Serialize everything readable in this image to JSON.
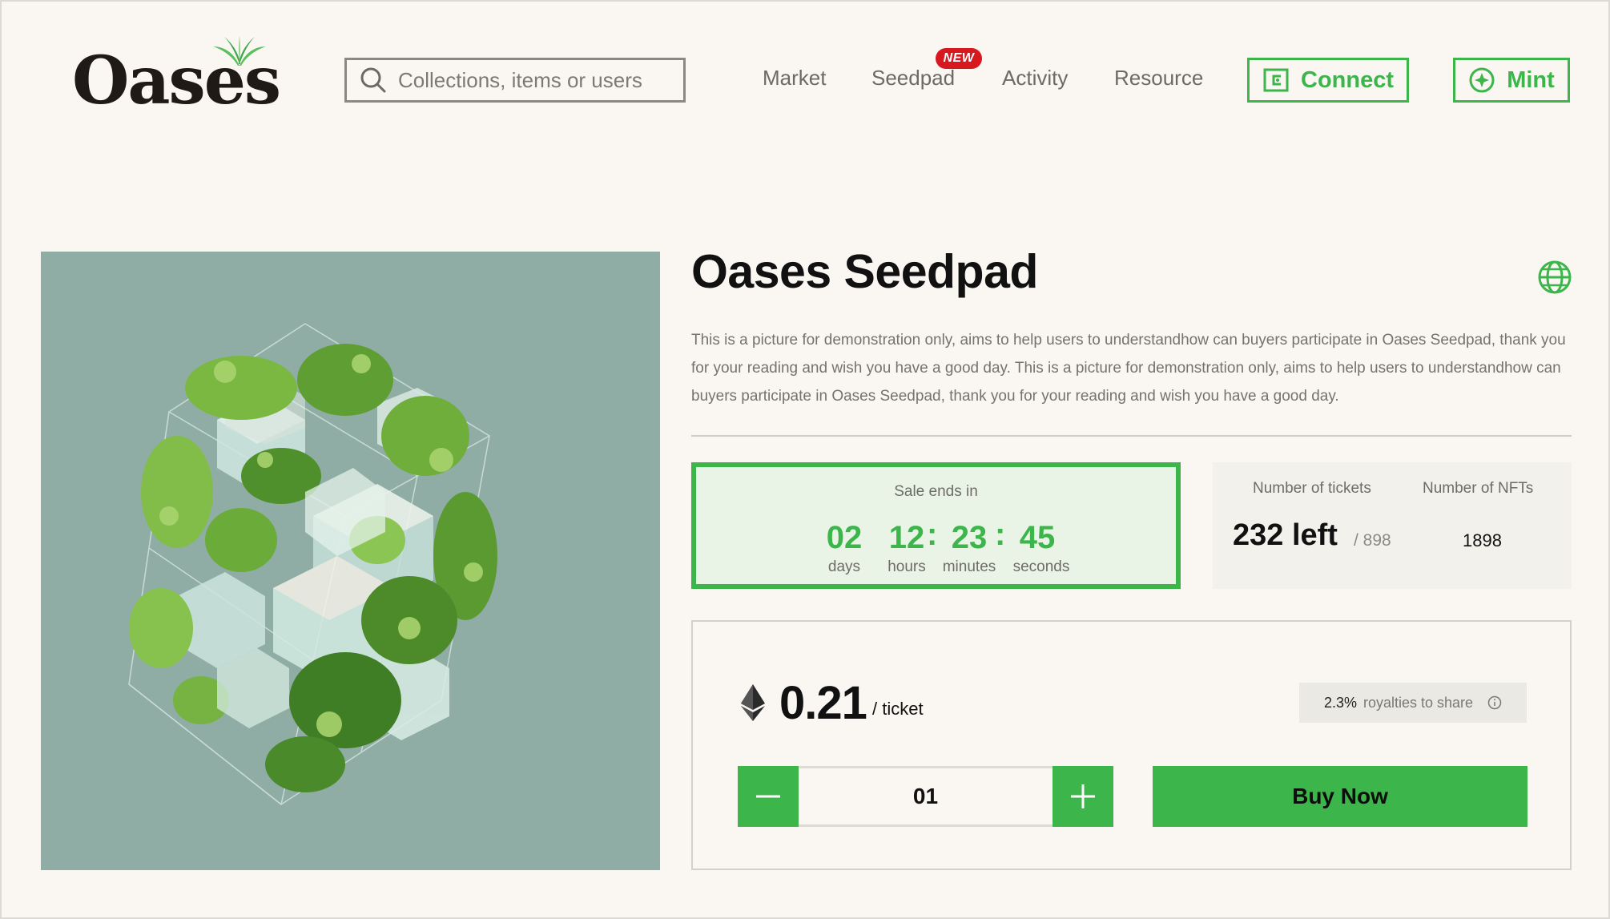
{
  "brand": {
    "logo_text": "Oases",
    "accent": "#3cb54a"
  },
  "header": {
    "search": {
      "placeholder": "Collections, items or users",
      "value": ""
    },
    "nav": [
      {
        "label": "Market"
      },
      {
        "label": "Seedpad",
        "badge": "NEW"
      },
      {
        "label": "Activity"
      },
      {
        "label": "Resource"
      }
    ],
    "connect_label": "Connect",
    "mint_label": "Mint"
  },
  "project": {
    "title": "Oases Seedpad",
    "description": "This is a picture for demonstration only, aims to help users to understandhow can buyers participate in Oases Seedpad, thank you for your reading and wish you have a good day. This is a picture for demonstration only, aims to help users to understandhow can buyers participate in Oases Seedpad, thank you for your reading and wish you have a good day."
  },
  "countdown": {
    "label": "Sale ends in",
    "days": "02",
    "hours": "12",
    "minutes": "23",
    "seconds": "45",
    "units": {
      "days": "days",
      "hours": "hours",
      "minutes": "minutes",
      "seconds": "seconds"
    }
  },
  "stats": {
    "tickets_label": "Number of tickets",
    "tickets_left": "232 left",
    "tickets_total": "/ 898",
    "nfts_label": "Number of NFTs",
    "nfts_value": "1898"
  },
  "purchase": {
    "price": "0.21",
    "price_unit": "/ ticket",
    "royalty_pct": "2.3%",
    "royalty_text": "royalties to share",
    "quantity": "01",
    "buy_label": "Buy Now"
  }
}
